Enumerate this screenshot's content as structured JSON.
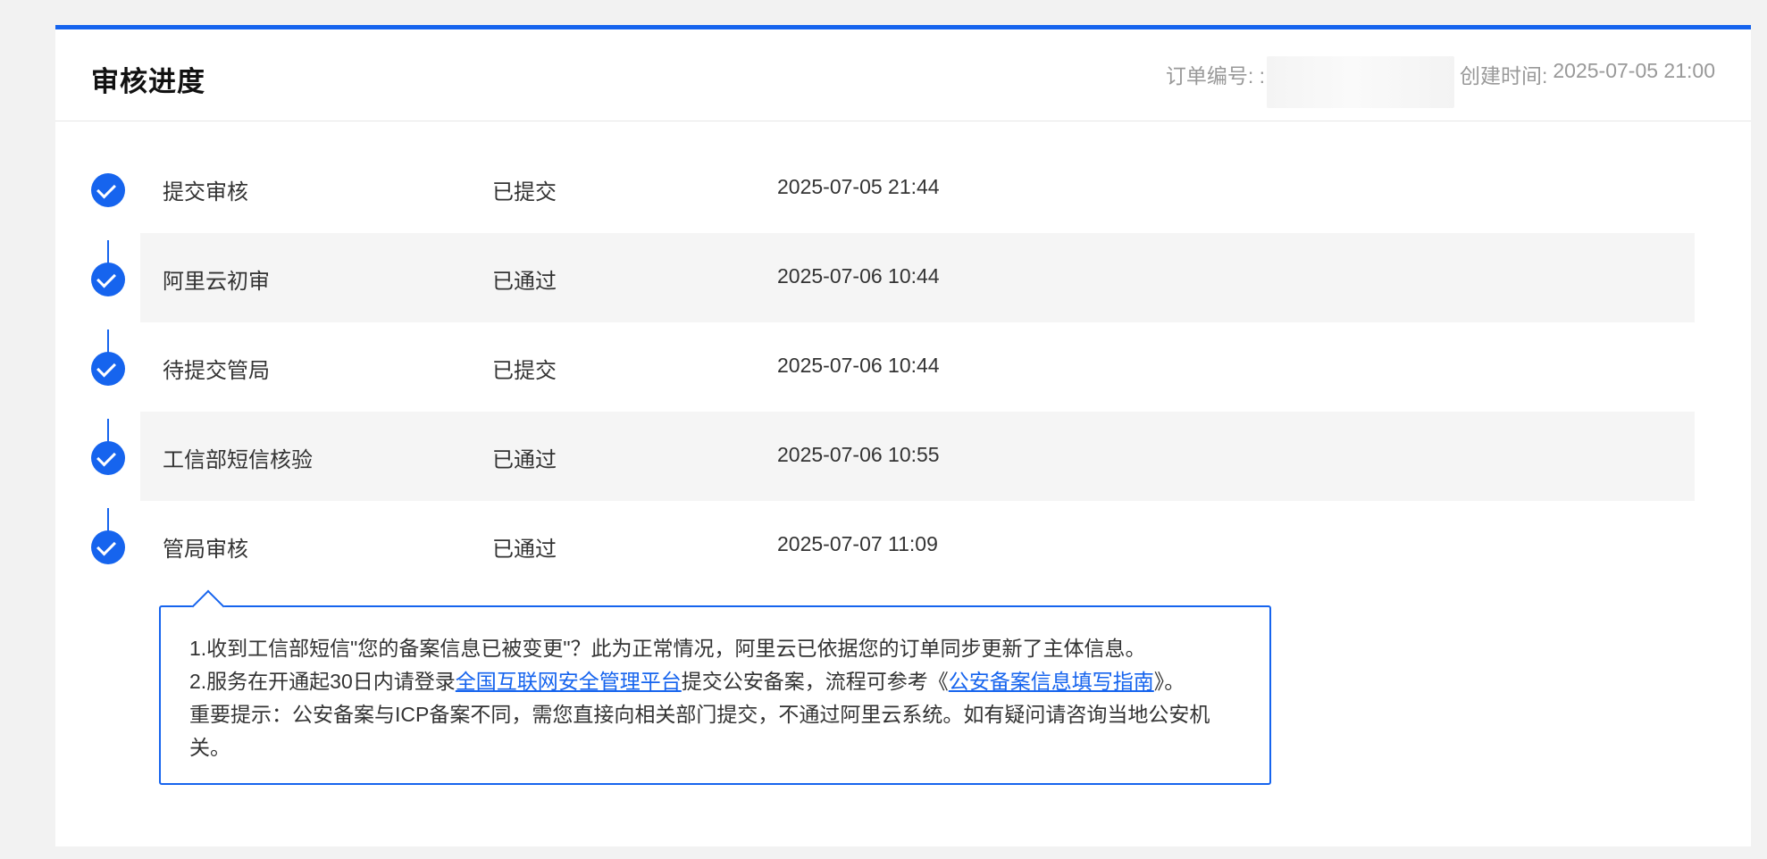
{
  "header": {
    "title": "审核进度",
    "order_label": "订单编号: :",
    "created_label": "创建时间:",
    "created_value": "2025-07-05 21:00"
  },
  "steps": [
    {
      "name": "提交审核",
      "status": "已提交",
      "time": "2025-07-05 21:44"
    },
    {
      "name": "阿里云初审",
      "status": "已通过",
      "time": "2025-07-06 10:44"
    },
    {
      "name": "待提交管局",
      "status": "已提交",
      "time": "2025-07-06 10:44"
    },
    {
      "name": "工信部短信核验",
      "status": "已通过",
      "time": "2025-07-06 10:55"
    },
    {
      "name": "管局审核",
      "status": "已通过",
      "time": "2025-07-07 11:09"
    }
  ],
  "notice": {
    "line1": "1.收到工信部短信\"您的备案信息已被变更\"？此为正常情况，阿里云已依据您的订单同步更新了主体信息。",
    "line2_prefix": "2.服务在开通起30日内请登录",
    "line2_link1": "全国互联网安全管理平台",
    "line2_middle": "提交公安备案，流程可参考《",
    "line2_link2": "公安备案信息填写指南",
    "line2_suffix": "》。",
    "line3": "重要提示：公安备案与ICP备案不同，需您直接向相关部门提交，不通过阿里云系统。如有疑问请咨询当地公安机关。"
  },
  "colors": {
    "accent": "#1664ee",
    "row_shade": "#f5f5f5",
    "meta_text": "#999999"
  },
  "icons": {
    "step_done": "check-circle-icon"
  }
}
